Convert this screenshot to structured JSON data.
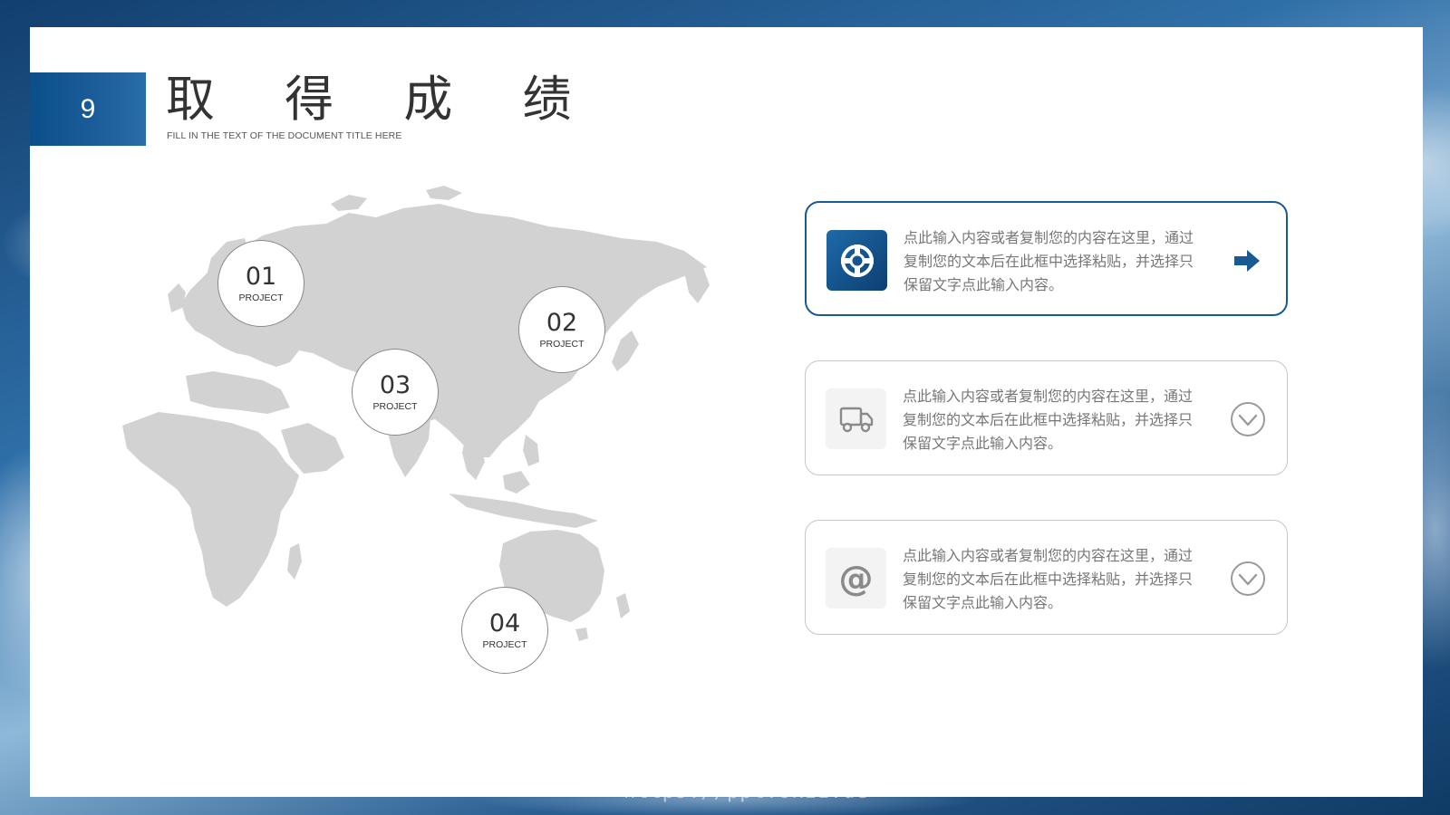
{
  "slide": {
    "number": "9",
    "title": "取 得 成 绩",
    "subtitle": "FILL IN THE TEXT OF THE DOCUMENT TITLE HERE"
  },
  "markers": [
    {
      "number": "01",
      "label": "PROJECT"
    },
    {
      "number": "02",
      "label": "PROJECT"
    },
    {
      "number": "03",
      "label": "PROJECT"
    },
    {
      "number": "04",
      "label": "PROJECT"
    }
  ],
  "cards": [
    {
      "icon": "lifebuoy-icon",
      "text": "点此输入内容或者复制您的内容在这里，通过复制您的文本后在此框中选择粘贴，并选择只保留文字点此输入内容。",
      "action": "arrow-right-icon",
      "state": "active"
    },
    {
      "icon": "truck-icon",
      "text": "点此输入内容或者复制您的内容在这里，通过复制您的文本后在此框中选择粘贴，并选择只保留文字点此输入内容。",
      "action": "chevron-down-icon",
      "state": "idle"
    },
    {
      "icon": "at-sign-icon",
      "text": "点此输入内容或者复制您的内容在这里，通过复制您的文本后在此框中选择粘贴，并选择只保留文字点此输入内容。",
      "action": "chevron-down-icon",
      "state": "idle"
    }
  ],
  "colors": {
    "accent": "#1a5a92",
    "map_fill": "#d2d2d2",
    "text_gray": "#777777"
  },
  "watermark": "https://ppt.ok11.de"
}
